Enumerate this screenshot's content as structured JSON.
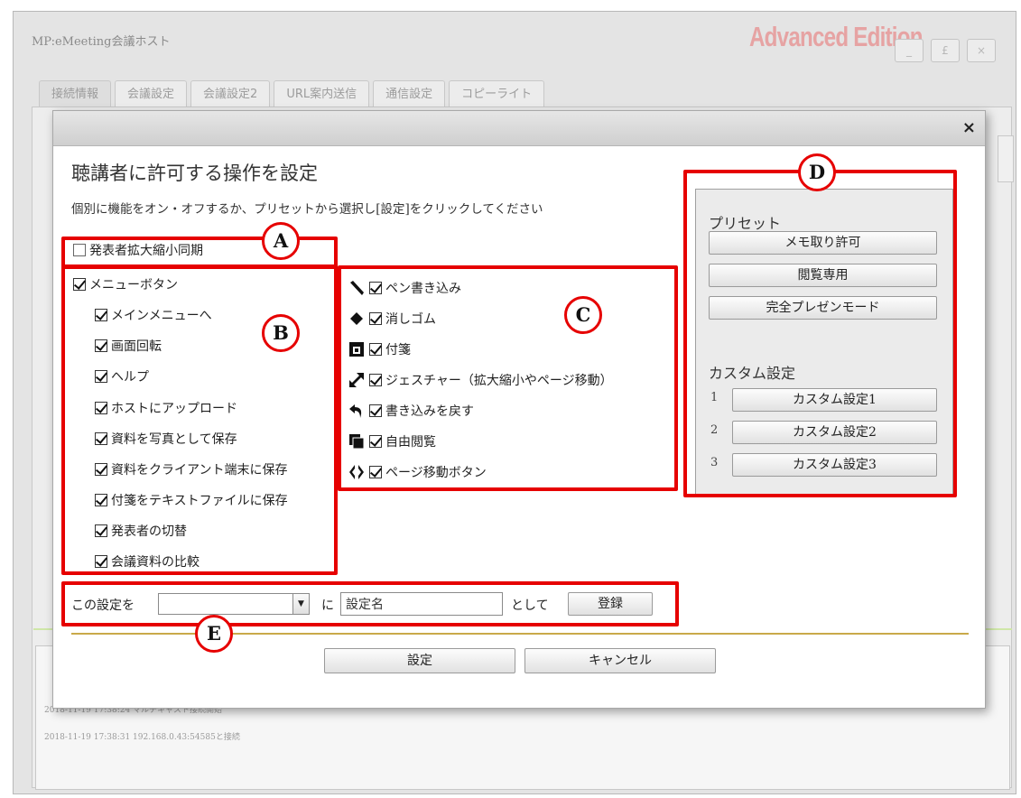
{
  "app": {
    "title": "MP:eMeeting会議ホスト",
    "brand": "Advanced Edition",
    "window_buttons": [
      "_",
      "£",
      "×"
    ],
    "tabs": [
      "接続情報",
      "会議設定",
      "会議設定2",
      "URL案内送信",
      "通信設定",
      "コピーライト"
    ],
    "logs": [
      "2018-11-19 17:38:24 マルチキャスト接続開始",
      "2018-11-19 17:38:31 192.168.0.43:54585と接続"
    ]
  },
  "dialog": {
    "close_label": "×",
    "title": "聴講者に許可する操作を設定",
    "subtitle": "個別に機能をオン・オフするか、プリセットから選択し[設定]をクリックしてください",
    "sync_zoom": {
      "label": "発表者拡大縮小同期",
      "checked": false
    },
    "menu_group": {
      "label": "メニューボタン",
      "checked": true,
      "items": [
        {
          "label": "メインメニューへ",
          "checked": true
        },
        {
          "label": "画面回転",
          "checked": true
        },
        {
          "label": "ヘルプ",
          "checked": true
        },
        {
          "label": "ホストにアップロード",
          "checked": true
        },
        {
          "label": "資料を写真として保存",
          "checked": true
        },
        {
          "label": "資料をクライアント端末に保存",
          "checked": true
        },
        {
          "label": "付箋をテキストファイルに保存",
          "checked": true
        },
        {
          "label": "発表者の切替",
          "checked": true
        },
        {
          "label": "会議資料の比較",
          "checked": true
        }
      ]
    },
    "tools": [
      {
        "icon": "pen-icon",
        "label": "ペン書き込み",
        "checked": true
      },
      {
        "icon": "eraser-icon",
        "label": "消しゴム",
        "checked": true
      },
      {
        "icon": "sticky-note-icon",
        "label": "付箋",
        "checked": true
      },
      {
        "icon": "gesture-icon",
        "label": "ジェスチャー（拡大縮小やページ移動）",
        "checked": true
      },
      {
        "icon": "undo-icon",
        "label": "書き込みを戻す",
        "checked": true
      },
      {
        "icon": "free-view-icon",
        "label": "自由閲覧",
        "checked": true
      },
      {
        "icon": "page-nav-icon",
        "label": "ページ移動ボタン",
        "checked": true
      }
    ],
    "presets": {
      "title": "プリセット",
      "buttons": [
        "メモ取り許可",
        "閲覧専用",
        "完全プレゼンモード"
      ]
    },
    "custom": {
      "title": "カスタム設定",
      "items": [
        {
          "number": "1",
          "label": "カスタム設定1"
        },
        {
          "number": "2",
          "label": "カスタム設定2"
        },
        {
          "number": "3",
          "label": "カスタム設定3"
        }
      ]
    },
    "save_row": {
      "label": "この設定を",
      "select_value": "",
      "ni": "に",
      "name_value": "設定名",
      "toshite": "として",
      "register_label": "登録"
    },
    "ok_label": "設定",
    "cancel_label": "キャンセル"
  },
  "annotations": [
    "A",
    "B",
    "C",
    "D",
    "E"
  ],
  "colors": {
    "annotation_red": "#e60000",
    "divider_gold": "#c9a94a",
    "brand_pink": "#e6a3a3"
  }
}
